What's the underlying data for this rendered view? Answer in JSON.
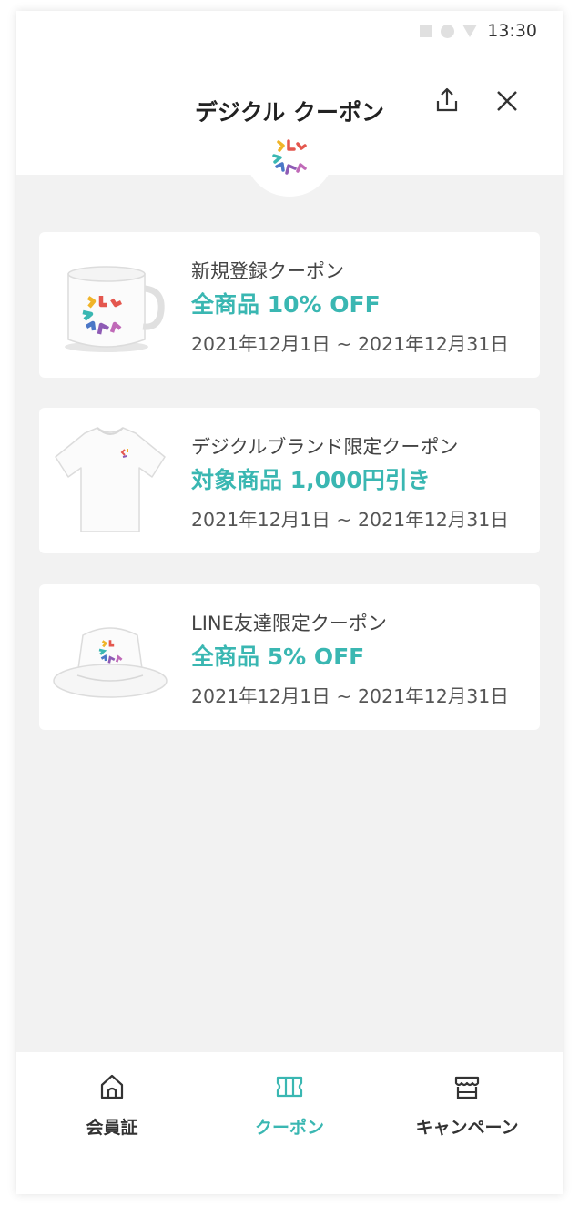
{
  "status_bar": {
    "time": "13:30"
  },
  "header": {
    "title": "デジクル クーポン"
  },
  "coupons": [
    {
      "name": "新規登録クーポン",
      "offer": "全商品 10% OFF",
      "period": "2021年12月1日 ~ 2021年12月31日",
      "image": "mug"
    },
    {
      "name": "デジクルブランド限定クーポン",
      "offer": "対象商品 1,000円引き",
      "period": "2021年12月1日 ~ 2021年12月31日",
      "image": "t-shirt"
    },
    {
      "name": "LINE友達限定クーポン",
      "offer": "全商品 5% OFF",
      "period": "2021年12月1日 ~ 2021年12月31日",
      "image": "bucket-hat"
    }
  ],
  "tabbar": {
    "items": [
      {
        "label": "会員証",
        "icon": "home-icon",
        "active": false
      },
      {
        "label": "クーポン",
        "icon": "ticket-icon",
        "active": true
      },
      {
        "label": "キャンペーン",
        "icon": "store-icon",
        "active": false
      }
    ]
  },
  "colors": {
    "accent": "#3ab7b2",
    "background": "#f2f2f2",
    "card": "#ffffff"
  }
}
